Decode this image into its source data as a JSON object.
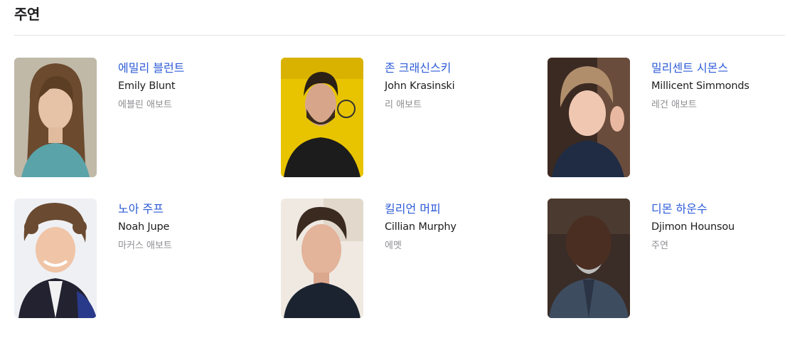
{
  "section": {
    "title": "주연"
  },
  "cast": [
    {
      "korean_name": "에밀리 블런트",
      "english_name": "Emily Blunt",
      "role": "에블린 애보트"
    },
    {
      "korean_name": "존 크래신스키",
      "english_name": "John Krasinski",
      "role": "리 애보트"
    },
    {
      "korean_name": "밀리센트 시몬스",
      "english_name": "Millicent Simmonds",
      "role": "레건 애보트"
    },
    {
      "korean_name": "노아 주프",
      "english_name": "Noah Jupe",
      "role": "마커스 애보트"
    },
    {
      "korean_name": "킬리언 머피",
      "english_name": "Cillian Murphy",
      "role": "에멧"
    },
    {
      "korean_name": "디몬 하운수",
      "english_name": "Djimon Hounsou",
      "role": "주연"
    }
  ],
  "colors": {
    "link_blue": "#2d5bd7",
    "text_dark": "#1d1d1f",
    "text_gray": "#8e8e93",
    "divider": "#e3e3e3"
  }
}
